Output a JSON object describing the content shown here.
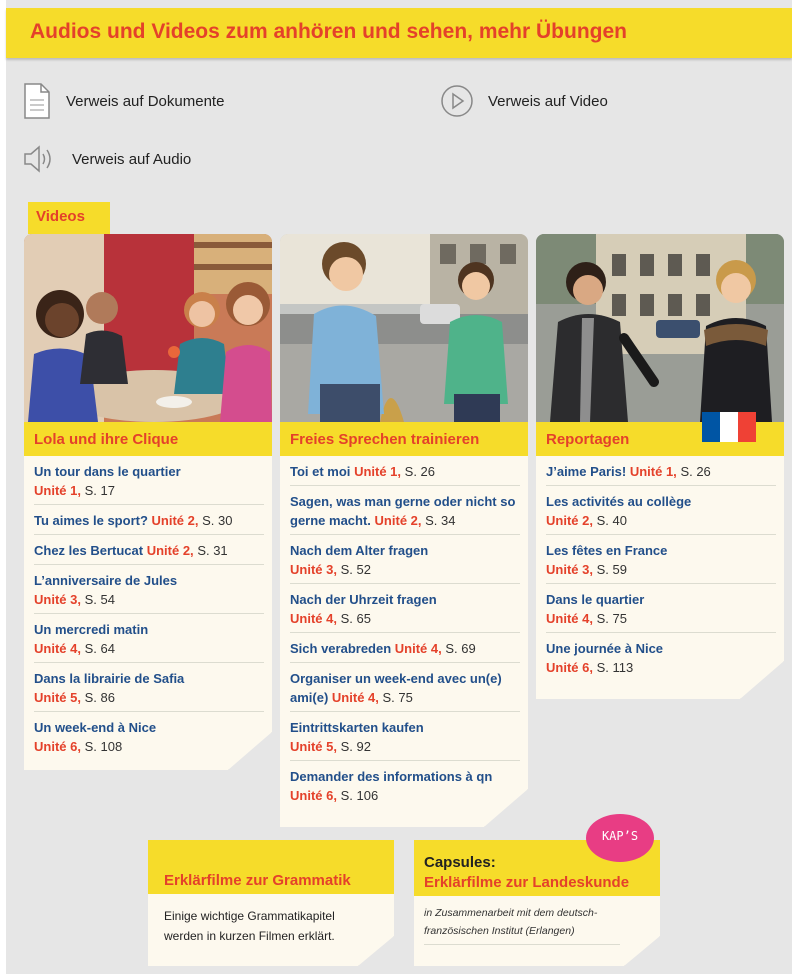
{
  "banner": {
    "title": "Audios und Videos zum anhören und sehen, mehr Übungen"
  },
  "legend": {
    "documents": "Verweis auf Dokumente",
    "video": "Verweis auf Video",
    "audio": "Verweis auf Audio"
  },
  "videos_tag": "Videos",
  "colors": {
    "yellow": "#f6dc2a",
    "red": "#e4412a",
    "blue": "#224f8a",
    "pink": "#e83d84"
  },
  "columns": [
    {
      "title": "Lola und ihre Clique",
      "items": [
        {
          "title": "Un tour dans le quartier",
          "unit": "Unité 1,",
          "page": "S. 17"
        },
        {
          "title": "Tu aimes le sport?",
          "unit": "Unité 2,",
          "page": "S. 30"
        },
        {
          "title": "Chez les Bertucat",
          "unit": "Unité 2,",
          "page": "S. 31"
        },
        {
          "title": "L’anniversaire de Jules",
          "unit": "Unité 3,",
          "page": "S. 54"
        },
        {
          "title": "Un mercredi matin",
          "unit": "Unité 4,",
          "page": "S. 64"
        },
        {
          "title": "Dans la librairie de Safia",
          "unit": "Unité 5,",
          "page": "S. 86"
        },
        {
          "title": "Un week-end à Nice",
          "unit": "Unité 6,",
          "page": "S. 108"
        }
      ]
    },
    {
      "title": "Freies Sprechen trainieren",
      "items": [
        {
          "title": "Toi et moi",
          "unit": "Unité 1,",
          "page": "S. 26"
        },
        {
          "title": "Sagen, was man gerne oder nicht so gerne macht.",
          "unit": "Unité 2,",
          "page": "S. 34"
        },
        {
          "title": "Nach dem Alter fragen",
          "unit": "Unité 3,",
          "page": "S. 52"
        },
        {
          "title": "Nach der Uhrzeit fragen",
          "unit": "Unité 4,",
          "page": "S. 65"
        },
        {
          "title": "Sich verabreden",
          "unit": "Unité 4,",
          "page": "S. 69"
        },
        {
          "title": "Organiser un week-end avec un(e) ami(e)",
          "unit": "Unité 4,",
          "page": "S. 75"
        },
        {
          "title": "Eintrittskarten kaufen",
          "unit": "Unité 5,",
          "page": "S. 92"
        },
        {
          "title": "Demander des informations à qn",
          "unit": "Unité 6,",
          "page": "S. 106"
        }
      ]
    },
    {
      "title": "Reportagen",
      "items": [
        {
          "title": "J’aime Paris!",
          "unit": "Unité 1,",
          "page": "S. 26"
        },
        {
          "title": "Les activités au collège",
          "unit": "Unité 2,",
          "page": "S. 40"
        },
        {
          "title": "Les fêtes en France",
          "unit": "Unité 3,",
          "page": "S. 59"
        },
        {
          "title": "Dans le quartier",
          "unit": "Unité 4,",
          "page": "S. 75"
        },
        {
          "title": "Une journée à Nice",
          "unit": "Unité 6,",
          "page": "S. 113"
        }
      ]
    }
  ],
  "grammar": {
    "title": "Erklärfilme zur Grammatik",
    "text_line1": "Einige wichtige Grammatikapitel",
    "text_line2": "werden in kurzen Filmen erklärt."
  },
  "capsules": {
    "label": "Capsules:",
    "title": "Erklärfilme zur Landeskunde",
    "note_line1": "in Zusammenarbeit mit dem deutsch-",
    "note_line2": "französischen Institut (Erlangen)",
    "badge": "KAP’S"
  }
}
